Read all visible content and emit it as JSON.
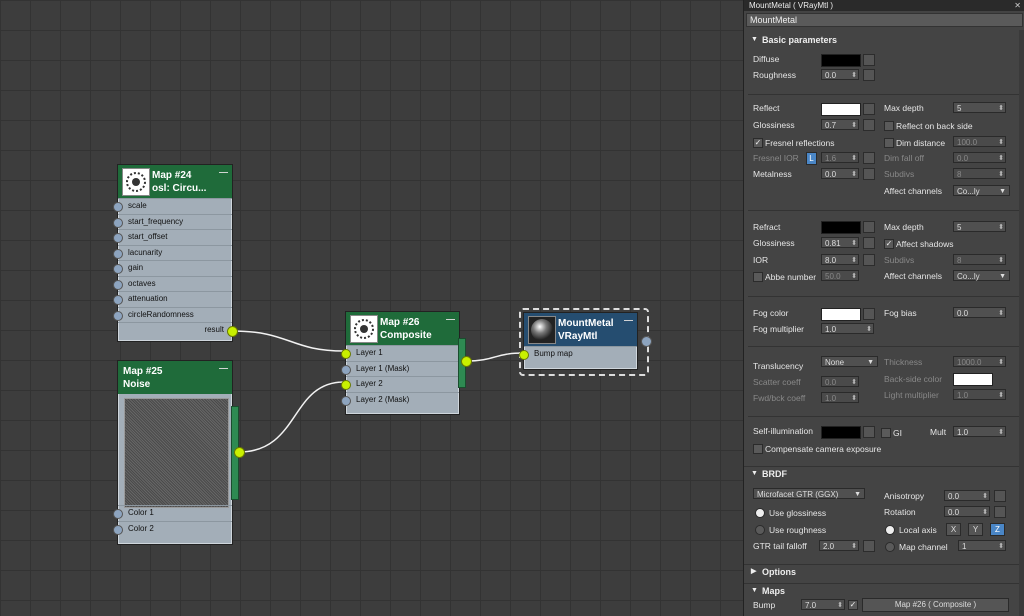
{
  "panel": {
    "title": "MountMetal  ( VRayMtl )",
    "material_name": "MountMetal",
    "basic": {
      "header": "Basic parameters",
      "diffuse_label": "Diffuse",
      "diffuse_color": "#000000",
      "roughness_label": "Roughness",
      "roughness_value": "0.0",
      "reflect_label": "Reflect",
      "reflect_color": "#ffffff",
      "glossiness_label": "Glossiness",
      "reflect_glossiness_value": "0.7",
      "fresnel_label": "Fresnel reflections",
      "fresnel_ior_label": "Fresnel IOR",
      "fresnel_ior_lock": "L",
      "fresnel_ior_value": "1.6",
      "metalness_label": "Metalness",
      "metalness_value": "0.0",
      "max_depth_label": "Max depth",
      "reflect_max_depth": "5",
      "reflect_back_label": "Reflect on back side",
      "dim_distance_label": "Dim distance",
      "dim_distance_value": "100.0",
      "dim_falloff_label": "Dim fall off",
      "dim_falloff_value": "0.0",
      "subdivs_label": "Subdivs",
      "reflect_subdivs": "8",
      "affect_channels_label": "Affect channels",
      "reflect_affect_value": "Co...ly",
      "refract_label": "Refract",
      "refract_color": "#000000",
      "refract_glossiness_value": "0.81",
      "ior_label": "IOR",
      "ior_value": "8.0",
      "abbe_label": "Abbe number",
      "abbe_value": "50.0",
      "refract_max_depth": "5",
      "affect_shadows_label": "Affect shadows",
      "refract_subdivs": "8",
      "refract_affect_value": "Co...ly",
      "fog_color_label": "Fog color",
      "fog_color": "#ffffff",
      "fog_bias_label": "Fog bias",
      "fog_bias_value": "0.0",
      "fog_multiplier_label": "Fog multiplier",
      "fog_multiplier_value": "1.0",
      "translucency_label": "Translucency",
      "translucency_value": "None",
      "thickness_label": "Thickness",
      "thickness_value": "1000.0",
      "scatter_label": "Scatter coeff",
      "scatter_value": "0.0",
      "backside_color_label": "Back-side color",
      "backside_color": "#ffffff",
      "fwd_label": "Fwd/bck coeff",
      "fwd_value": "1.0",
      "light_mult_label": "Light multiplier",
      "light_mult_value": "1.0",
      "self_illum_label": "Self-illumination",
      "self_illum_color": "#000000",
      "gi_label": "GI",
      "mult_label": "Mult",
      "mult_value": "1.0",
      "compensate_label": "Compensate camera exposure"
    },
    "brdf": {
      "header": "BRDF",
      "type_value": "Microfacet GTR (GGX)",
      "use_glossiness_label": "Use glossiness",
      "use_roughness_label": "Use roughness",
      "gtr_tail_label": "GTR tail falloff",
      "gtr_tail_value": "2.0",
      "anisotropy_label": "Anisotropy",
      "anisotropy_value": "0.0",
      "rotation_label": "Rotation",
      "rotation_value": "0.0",
      "local_axis_label": "Local axis",
      "axis_x": "X",
      "axis_y": "Y",
      "axis_z": "Z",
      "map_channel_label": "Map channel",
      "map_channel_value": "1"
    },
    "options": {
      "header": "Options"
    },
    "maps": {
      "header": "Maps",
      "bump_label": "Bump",
      "bump_value": "7.0",
      "bump_map": "Map #26  ( Composite )"
    }
  },
  "nodes": {
    "map24": {
      "title": "Map #24",
      "subtitle": "osl: Circu...",
      "inputs": [
        "scale",
        "start_frequency",
        "start_offset",
        "lacunarity",
        "gain",
        "octaves",
        "attenuation",
        "circleRandomness"
      ],
      "output": "result"
    },
    "map25": {
      "title": "Map #25",
      "subtitle": "Noise",
      "inputs": [
        "Color 1",
        "Color 2"
      ]
    },
    "map26": {
      "title": "Map #26",
      "subtitle": "Composite",
      "inputs": [
        "Layer 1",
        "Layer 1 (Mask)",
        "Layer 2",
        "Layer 2 (Mask)"
      ]
    },
    "mount": {
      "title": "MountMetal",
      "subtitle": "VRayMtl",
      "inputs": [
        "Bump map"
      ]
    }
  }
}
